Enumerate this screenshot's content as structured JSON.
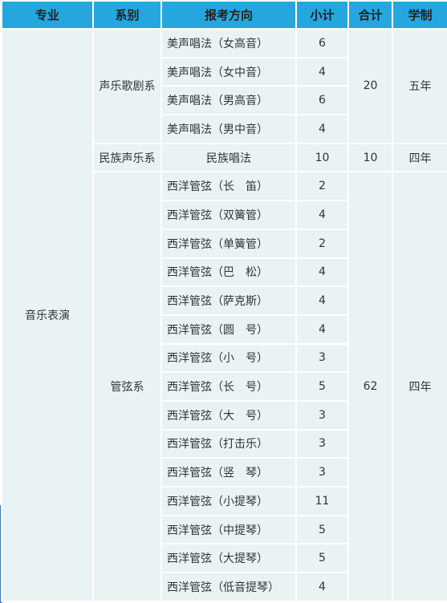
{
  "headers": [
    "专业",
    "系别",
    "报考方向",
    "小计",
    "合计",
    "学制"
  ],
  "major": "音乐表演",
  "departments": [
    {
      "name": "声乐歌剧系",
      "total": "20",
      "duration": "五年",
      "rows": [
        {
          "direction": "美声唱法（女高音）",
          "count": "6"
        },
        {
          "direction": "美声唱法（女中音）",
          "count": "4"
        },
        {
          "direction": "美声唱法（男高音）",
          "count": "6"
        },
        {
          "direction": "美声唱法（男中音）",
          "count": "4"
        }
      ]
    },
    {
      "name": "民族声乐系",
      "total": "10",
      "duration": "四年",
      "rows": [
        {
          "direction": "民族唱法",
          "count": "10"
        }
      ]
    },
    {
      "name": "管弦系",
      "total": "62",
      "duration": "四年",
      "rows": [
        {
          "direction": "西洋管弦（长　笛）",
          "count": "2"
        },
        {
          "direction": "西洋管弦（双簧管）",
          "count": "4"
        },
        {
          "direction": "西洋管弦（单簧管）",
          "count": "2"
        },
        {
          "direction": "西洋管弦（巴　松）",
          "count": "4"
        },
        {
          "direction": "西洋管弦（萨克斯）",
          "count": "4"
        },
        {
          "direction": "西洋管弦（圆　号）",
          "count": "4"
        },
        {
          "direction": "西洋管弦（小　号）",
          "count": "3"
        },
        {
          "direction": "西洋管弦（长　号）",
          "count": "5"
        },
        {
          "direction": "西洋管弦（大　号）",
          "count": "3"
        },
        {
          "direction": "西洋管弦（打击乐）",
          "count": "3"
        },
        {
          "direction": "西洋管弦（竖　琴）",
          "count": "3"
        },
        {
          "direction": "西洋管弦（小提琴）",
          "count": "11"
        },
        {
          "direction": "西洋管弦（中提琴）",
          "count": "5"
        },
        {
          "direction": "西洋管弦（大提琴）",
          "count": "5"
        },
        {
          "direction": "西洋管弦（低音提琴）",
          "count": "4"
        }
      ]
    }
  ],
  "colors": {
    "header": "#26a6df",
    "cell": "#e9f3f3",
    "border": "#ffffff"
  }
}
